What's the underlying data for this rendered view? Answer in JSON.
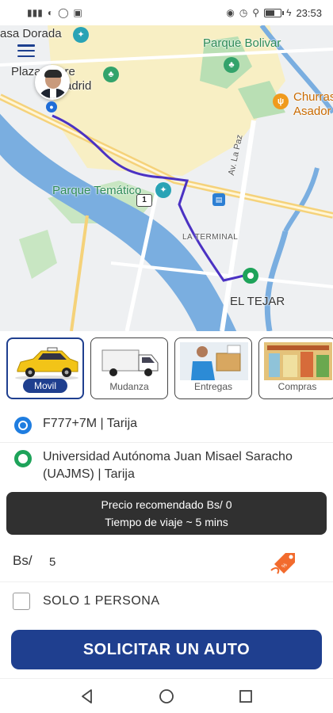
{
  "status_bar": {
    "time": "23:53",
    "left_icons": [
      "signal-icon",
      "media-icon",
      "whatsapp-icon",
      "gallery-icon"
    ],
    "right_icons": [
      "eye-icon",
      "alarm-icon",
      "location-icon",
      "battery-icon",
      "charging-icon"
    ],
    "battery_level": 0.6
  },
  "map": {
    "labels": {
      "casa_dorada": "asa Dorada",
      "parque_bolivar": "Parque Bolivar",
      "plaza_sucre_1": "Plaza Sucre",
      "plaza_sucre_2": "adrid",
      "churras_1": "Churras",
      "churras_2": "Asador",
      "parque_tematico": "Parque Temático",
      "la_terminal": "LA TERMINAL",
      "el_tejar": "EL TEJAR",
      "av_la_paz": "Av. La Paz",
      "route_shield": "1"
    },
    "colors": {
      "river": "#7aaee0",
      "route": "#4b32c3",
      "park": "#b9dfb4",
      "urban": "#f8efc4",
      "road": "#f5d27a"
    }
  },
  "services": [
    {
      "label": "Movil",
      "icon": "taxi-icon",
      "selected": true
    },
    {
      "label": "Mudanza",
      "icon": "truck-icon",
      "selected": false
    },
    {
      "label": "Entregas",
      "icon": "delivery-icon",
      "selected": false
    },
    {
      "label": "Compras",
      "icon": "shopping-icon",
      "selected": false
    }
  ],
  "origin": {
    "text": "F777+7M  | Tarija"
  },
  "destination": {
    "text": "Universidad Autónoma Juan Misael Saracho (UAJMS)  | Tarija"
  },
  "price_info": {
    "line1": "Precio recomendado Bs/ 0",
    "line2": "Tiempo de viaje ~ 5 mins"
  },
  "fare": {
    "label": "Bs/",
    "value": "5"
  },
  "solo": {
    "label": "SOLO 1 PERSONA",
    "checked": false
  },
  "cta": {
    "label": "SOLICITAR UN AUTO",
    "color": "#1f3f8f"
  },
  "nav": {
    "back": "back-icon",
    "home": "home-icon",
    "recents": "recents-icon"
  }
}
